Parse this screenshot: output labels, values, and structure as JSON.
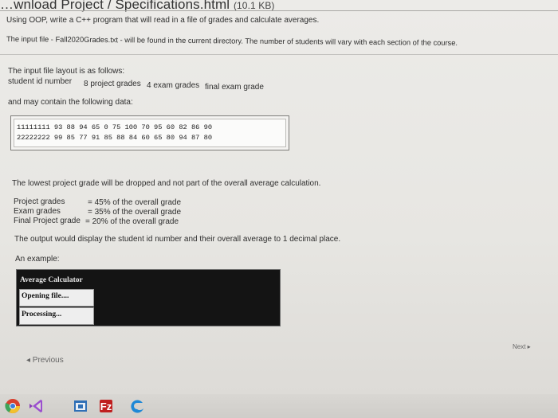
{
  "header": {
    "title": "…wnload Project / Specifications.html",
    "file_size": "(10.1 KB)"
  },
  "intro": {
    "line1": "Using OOP, write a C++ program that will read in a file of grades and calculate averages.",
    "line2": "The input file - Fall2020Grades.txt - will be found in the current directory.  The number of students will vary with each section of the course."
  },
  "layout": {
    "heading": "The input file layout is as follows:",
    "fields": [
      "student id number",
      "8 project grades",
      "4 exam grades",
      "final exam grade"
    ]
  },
  "sample": {
    "label": "and may contain the following data:",
    "rows": [
      "11111111  93  88  94  65  0  75  100  70  95  60  82  86  90",
      "22222222  99  85  77  91  85  88  84  60  65  80  94  87  80"
    ]
  },
  "rules": {
    "drop_note": "The lowest project grade will be dropped and not part of the overall average calculation.",
    "weights": [
      {
        "label": "Project grades",
        "value": "= 45% of the overall grade"
      },
      {
        "label": "Exam grades",
        "value": "= 35% of the overall grade"
      },
      {
        "label": "Final Project grade",
        "value": "= 20% of the overall grade"
      }
    ],
    "output_note": "The output would display the student id number and their overall average to 1 decimal place.",
    "example_label": "An example:"
  },
  "console": {
    "title": "Average Calculator",
    "opening": "Opening file....",
    "processing": "Processing..."
  },
  "nav": {
    "previous": "◂ Previous",
    "next": "Next ▸"
  },
  "taskbar": {
    "icons": [
      "chrome-icon",
      "visual-studio-icon",
      "app-window-icon",
      "filezilla-icon",
      "edge-icon"
    ]
  },
  "colors": {
    "console_bg": "#141414",
    "filezilla": "#bf1e1e",
    "visual_studio": "#8a3fb8",
    "edge": "#1e88d6"
  }
}
